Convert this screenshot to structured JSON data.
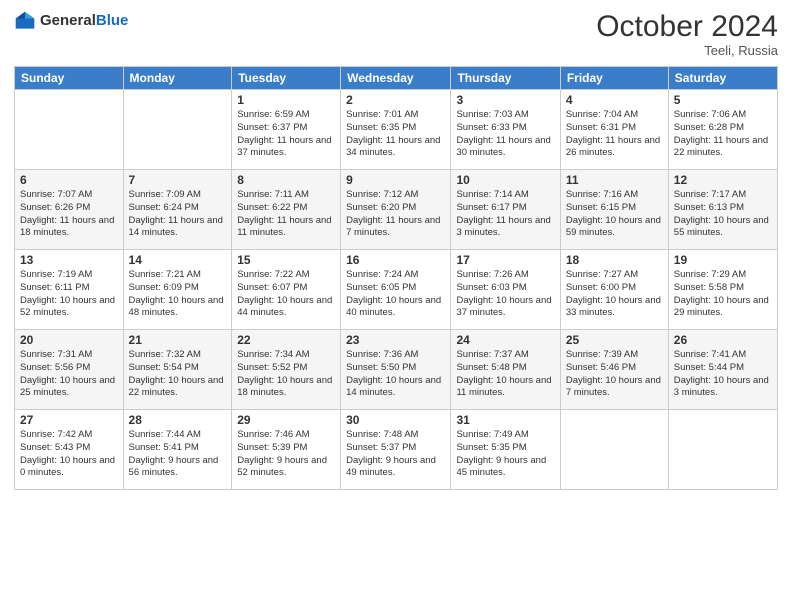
{
  "header": {
    "logo_general": "General",
    "logo_blue": "Blue",
    "month_title": "October 2024",
    "location": "Teeli, Russia"
  },
  "days_header": [
    "Sunday",
    "Monday",
    "Tuesday",
    "Wednesday",
    "Thursday",
    "Friday",
    "Saturday"
  ],
  "weeks": [
    [
      {
        "day": "",
        "info": ""
      },
      {
        "day": "",
        "info": ""
      },
      {
        "day": "1",
        "info": "Sunrise: 6:59 AM\nSunset: 6:37 PM\nDaylight: 11 hours and 37 minutes."
      },
      {
        "day": "2",
        "info": "Sunrise: 7:01 AM\nSunset: 6:35 PM\nDaylight: 11 hours and 34 minutes."
      },
      {
        "day": "3",
        "info": "Sunrise: 7:03 AM\nSunset: 6:33 PM\nDaylight: 11 hours and 30 minutes."
      },
      {
        "day": "4",
        "info": "Sunrise: 7:04 AM\nSunset: 6:31 PM\nDaylight: 11 hours and 26 minutes."
      },
      {
        "day": "5",
        "info": "Sunrise: 7:06 AM\nSunset: 6:28 PM\nDaylight: 11 hours and 22 minutes."
      }
    ],
    [
      {
        "day": "6",
        "info": "Sunrise: 7:07 AM\nSunset: 6:26 PM\nDaylight: 11 hours and 18 minutes."
      },
      {
        "day": "7",
        "info": "Sunrise: 7:09 AM\nSunset: 6:24 PM\nDaylight: 11 hours and 14 minutes."
      },
      {
        "day": "8",
        "info": "Sunrise: 7:11 AM\nSunset: 6:22 PM\nDaylight: 11 hours and 11 minutes."
      },
      {
        "day": "9",
        "info": "Sunrise: 7:12 AM\nSunset: 6:20 PM\nDaylight: 11 hours and 7 minutes."
      },
      {
        "day": "10",
        "info": "Sunrise: 7:14 AM\nSunset: 6:17 PM\nDaylight: 11 hours and 3 minutes."
      },
      {
        "day": "11",
        "info": "Sunrise: 7:16 AM\nSunset: 6:15 PM\nDaylight: 10 hours and 59 minutes."
      },
      {
        "day": "12",
        "info": "Sunrise: 7:17 AM\nSunset: 6:13 PM\nDaylight: 10 hours and 55 minutes."
      }
    ],
    [
      {
        "day": "13",
        "info": "Sunrise: 7:19 AM\nSunset: 6:11 PM\nDaylight: 10 hours and 52 minutes."
      },
      {
        "day": "14",
        "info": "Sunrise: 7:21 AM\nSunset: 6:09 PM\nDaylight: 10 hours and 48 minutes."
      },
      {
        "day": "15",
        "info": "Sunrise: 7:22 AM\nSunset: 6:07 PM\nDaylight: 10 hours and 44 minutes."
      },
      {
        "day": "16",
        "info": "Sunrise: 7:24 AM\nSunset: 6:05 PM\nDaylight: 10 hours and 40 minutes."
      },
      {
        "day": "17",
        "info": "Sunrise: 7:26 AM\nSunset: 6:03 PM\nDaylight: 10 hours and 37 minutes."
      },
      {
        "day": "18",
        "info": "Sunrise: 7:27 AM\nSunset: 6:00 PM\nDaylight: 10 hours and 33 minutes."
      },
      {
        "day": "19",
        "info": "Sunrise: 7:29 AM\nSunset: 5:58 PM\nDaylight: 10 hours and 29 minutes."
      }
    ],
    [
      {
        "day": "20",
        "info": "Sunrise: 7:31 AM\nSunset: 5:56 PM\nDaylight: 10 hours and 25 minutes."
      },
      {
        "day": "21",
        "info": "Sunrise: 7:32 AM\nSunset: 5:54 PM\nDaylight: 10 hours and 22 minutes."
      },
      {
        "day": "22",
        "info": "Sunrise: 7:34 AM\nSunset: 5:52 PM\nDaylight: 10 hours and 18 minutes."
      },
      {
        "day": "23",
        "info": "Sunrise: 7:36 AM\nSunset: 5:50 PM\nDaylight: 10 hours and 14 minutes."
      },
      {
        "day": "24",
        "info": "Sunrise: 7:37 AM\nSunset: 5:48 PM\nDaylight: 10 hours and 11 minutes."
      },
      {
        "day": "25",
        "info": "Sunrise: 7:39 AM\nSunset: 5:46 PM\nDaylight: 10 hours and 7 minutes."
      },
      {
        "day": "26",
        "info": "Sunrise: 7:41 AM\nSunset: 5:44 PM\nDaylight: 10 hours and 3 minutes."
      }
    ],
    [
      {
        "day": "27",
        "info": "Sunrise: 7:42 AM\nSunset: 5:43 PM\nDaylight: 10 hours and 0 minutes."
      },
      {
        "day": "28",
        "info": "Sunrise: 7:44 AM\nSunset: 5:41 PM\nDaylight: 9 hours and 56 minutes."
      },
      {
        "day": "29",
        "info": "Sunrise: 7:46 AM\nSunset: 5:39 PM\nDaylight: 9 hours and 52 minutes."
      },
      {
        "day": "30",
        "info": "Sunrise: 7:48 AM\nSunset: 5:37 PM\nDaylight: 9 hours and 49 minutes."
      },
      {
        "day": "31",
        "info": "Sunrise: 7:49 AM\nSunset: 5:35 PM\nDaylight: 9 hours and 45 minutes."
      },
      {
        "day": "",
        "info": ""
      },
      {
        "day": "",
        "info": ""
      }
    ]
  ]
}
